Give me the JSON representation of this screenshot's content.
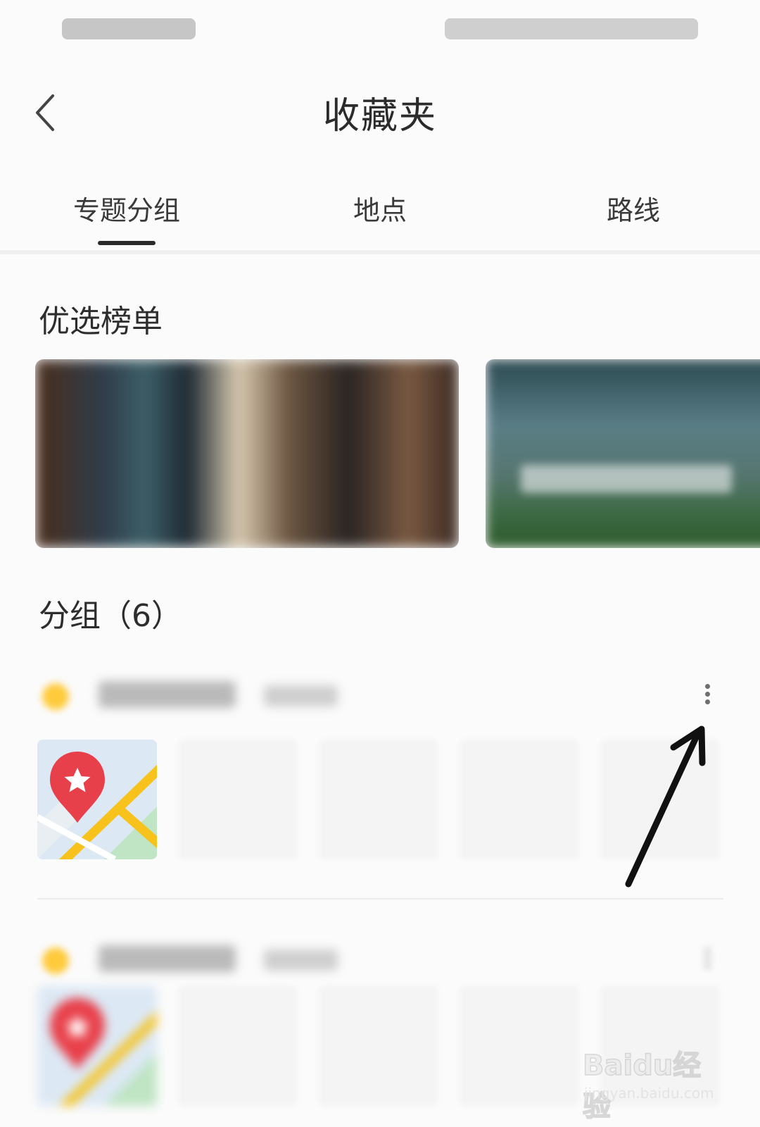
{
  "header": {
    "title": "收藏夹"
  },
  "tabs": [
    {
      "label": "专题分组",
      "active": true
    },
    {
      "label": "地点",
      "active": false
    },
    {
      "label": "路线",
      "active": false
    }
  ],
  "featured": {
    "title": "优选榜单"
  },
  "groups_section": {
    "title": "分组（6）"
  },
  "colors": {
    "accent_dot": "#ffcb3d",
    "pin_red": "#e8404a",
    "road_yellow": "#f6c21b",
    "tab_indicator": "#2a2a2a"
  },
  "watermark": {
    "logo": "Baidu经验",
    "url": "jingyan.baidu.com"
  }
}
